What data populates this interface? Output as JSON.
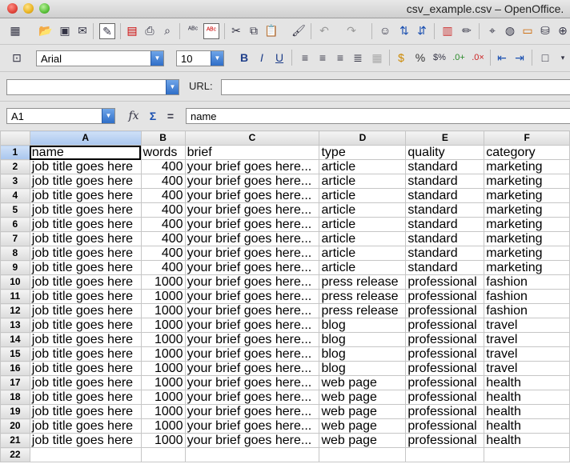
{
  "window": {
    "title": "csv_example.csv – OpenOffice."
  },
  "toolbar_font": {
    "font_name": "Arial",
    "font_size": "10"
  },
  "url_bar": {
    "label": "URL:",
    "value": ""
  },
  "formula_bar": {
    "cell_ref": "A1",
    "content": "name"
  },
  "sheet": {
    "columns": [
      "A",
      "B",
      "C",
      "D",
      "E",
      "F"
    ],
    "rows": [
      [
        "name",
        "words",
        "brief",
        "type",
        "quality",
        "category"
      ],
      [
        "job title goes here",
        "400",
        "your brief goes here...",
        "article",
        "standard",
        "marketing"
      ],
      [
        "job title goes here",
        "400",
        "your brief goes here...",
        "article",
        "standard",
        "marketing"
      ],
      [
        "job title goes here",
        "400",
        "your brief goes here...",
        "article",
        "standard",
        "marketing"
      ],
      [
        "job title goes here",
        "400",
        "your brief goes here...",
        "article",
        "standard",
        "marketing"
      ],
      [
        "job title goes here",
        "400",
        "your brief goes here...",
        "article",
        "standard",
        "marketing"
      ],
      [
        "job title goes here",
        "400",
        "your brief goes here...",
        "article",
        "standard",
        "marketing"
      ],
      [
        "job title goes here",
        "400",
        "your brief goes here...",
        "article",
        "standard",
        "marketing"
      ],
      [
        "job title goes here",
        "400",
        "your brief goes here...",
        "article",
        "standard",
        "marketing"
      ],
      [
        "job title goes here",
        "1000",
        "your brief goes here...",
        "press release",
        "professional",
        "fashion"
      ],
      [
        "job title goes here",
        "1000",
        "your brief goes here...",
        "press release",
        "professional",
        "fashion"
      ],
      [
        "job title goes here",
        "1000",
        "your brief goes here...",
        "press release",
        "professional",
        "fashion"
      ],
      [
        "job title goes here",
        "1000",
        "your brief goes here...",
        "blog",
        "professional",
        "travel"
      ],
      [
        "job title goes here",
        "1000",
        "your brief goes here...",
        "blog",
        "professional",
        "travel"
      ],
      [
        "job title goes here",
        "1000",
        "your brief goes here...",
        "blog",
        "professional",
        "travel"
      ],
      [
        "job title goes here",
        "1000",
        "your brief goes here...",
        "blog",
        "professional",
        "travel"
      ],
      [
        "job title goes here",
        "1000",
        "your brief goes here...",
        "web page",
        "professional",
        "health"
      ],
      [
        "job title goes here",
        "1000",
        "your brief goes here...",
        "web page",
        "professional",
        "health"
      ],
      [
        "job title goes here",
        "1000",
        "your brief goes here...",
        "web page",
        "professional",
        "health"
      ],
      [
        "job title goes here",
        "1000",
        "your brief goes here...",
        "web page",
        "professional",
        "health"
      ],
      [
        "job title goes here",
        "1000",
        "your brief goes here...",
        "web page",
        "professional",
        "health"
      ],
      [
        "",
        "",
        "",
        "",
        "",
        ""
      ]
    ]
  }
}
